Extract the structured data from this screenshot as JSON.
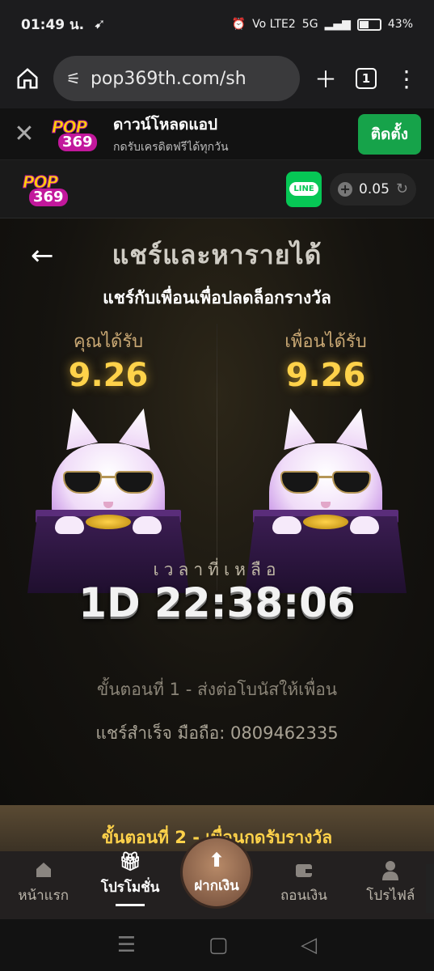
{
  "status_bar": {
    "time": "01:49 น.",
    "network": "Vo LTE2",
    "signal_label": "5G",
    "battery": "43%"
  },
  "browser": {
    "url": "pop369th.com/sh",
    "tab_count": "1",
    "icons": [
      "home-icon",
      "site-settings-icon",
      "new-tab-icon",
      "tab-switcher-icon",
      "menu-icon"
    ]
  },
  "app_banner": {
    "title": "ดาวน์โหลดแอป",
    "subtitle": "กดรับเครดิตฟรีได้ทุกวัน",
    "install_label": "ติดตั้ง",
    "logo_text": "POP",
    "logo_number": "369"
  },
  "site_header": {
    "line_label": "LINE",
    "balance": "0.05"
  },
  "page": {
    "title": "แชร์และหารายได้",
    "subtitle": "แชร์กับเพื่อนเพื่อปลดล็อกรางวัล",
    "you_receive_label": "คุณได้รับ",
    "you_receive_value": "9.26",
    "friend_receive_label": "เพื่อนได้รับ",
    "friend_receive_value": "9.26",
    "time_left_label": "เวลาที่เหลือ",
    "countdown": "1D 22:38:06",
    "step1": "ขั้นตอนที่ 1 - ส่งต่อโบนัสให้เพื่อน",
    "share_success": "แชร์สำเร็จ มือถือ: 0809462335",
    "step2": "ขั้นตอนที่ 2 - เพื่อนกดรับรางวัล"
  },
  "bottom_nav": {
    "items": [
      {
        "label": "หน้าแรก",
        "icon": "home-icon"
      },
      {
        "label": "โปรโมชั่น",
        "icon": "gift-icon"
      },
      {
        "label": "ฝากเงิน",
        "icon": "deposit-icon"
      },
      {
        "label": "ถอนเงิน",
        "icon": "wallet-icon"
      },
      {
        "label": "โปรไฟล์",
        "icon": "profile-icon"
      }
    ],
    "active_index": 1
  },
  "colors": {
    "accent_gold": "#ffd24a",
    "install_green": "#16a34a",
    "line_green": "#06c755"
  }
}
